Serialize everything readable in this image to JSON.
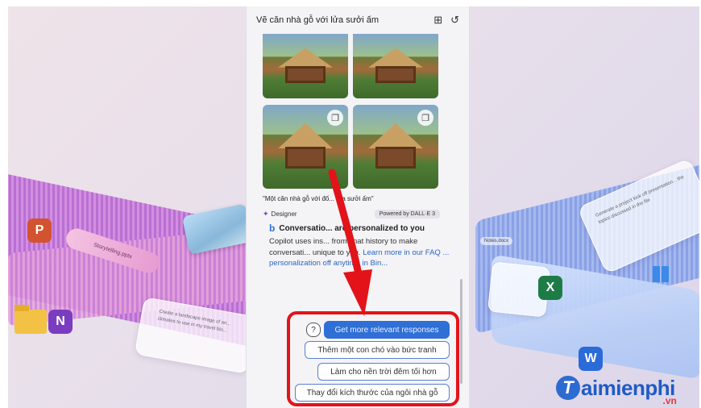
{
  "panel": {
    "title": "Vẽ căn nhà gỗ với lửa sưởi ấm",
    "header_icons": [
      "grid-icon",
      "history-icon"
    ]
  },
  "images": {
    "caption": "\"Một căn nhà gỗ với đố... lửa sưởi ấm\"",
    "designer_label": "Designer",
    "powered_by": "Powered by DALL·E 3"
  },
  "conversation": {
    "heading": "Conversatio... are personalized to you",
    "body_prefix": "Copilot uses ins... from chat history to make conversati... unique to you. ",
    "link_text": "Learn more in our FAQ ... personalization off anytime in Bin..."
  },
  "suggestions": {
    "primary": "Get more relevant responses",
    "items": [
      "Thêm một con chó vào bức tranh",
      "Làm cho nền trời đêm tối hơn",
      "Thay đổi kích thước của ngôi nhà gỗ"
    ]
  },
  "background": {
    "pill_doc": "Storytelling.pptx",
    "card_left": "Create a landscape image of an... climates to use in my travel blo...",
    "card_right": "Generate a project kick off presentation... the topics discussed in the file",
    "right_chip": "Notes.docx"
  },
  "watermark": {
    "brand": "aimienphi",
    "initial": "T",
    "suffix": ".vn"
  },
  "colors": {
    "accent_blue": "#2f6fd6",
    "highlight_red": "#e3131a"
  }
}
